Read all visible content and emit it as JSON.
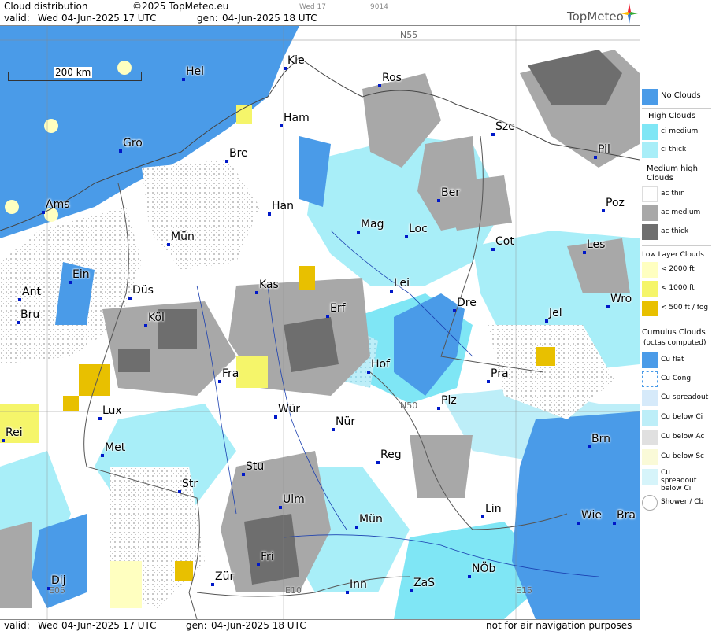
{
  "header": {
    "title": "Cloud distribution",
    "copyright": "©2025 TopMeteo.eu",
    "tab_label": "Wed 17",
    "code": "9014",
    "valid_label": "valid:",
    "valid_value": "Wed  04-Jun-2025  17 UTC",
    "gen_label": "gen:",
    "gen_value": "04-Jun-2025 18 UTC",
    "logo": "TopMeteo"
  },
  "footer": {
    "valid_label": "valid:",
    "valid_value": "Wed  04-Jun-2025  17 UTC",
    "gen_label": "gen:",
    "gen_value": "04-Jun-2025 18 UTC",
    "disclaimer": "not for air navigation purposes"
  },
  "scale": {
    "label": "200 km"
  },
  "grid_labels": [
    "N55",
    "N50",
    "E05",
    "E10",
    "E15"
  ],
  "cities": [
    "Kie",
    "Hel",
    "Ros",
    "Ham",
    "Szc",
    "Gro",
    "Bre",
    "Pil",
    "Ber",
    "Ams",
    "Han",
    "Mag",
    "Loc",
    "Poz",
    "Mün",
    "Cot",
    "Les",
    "Ein",
    "Kas",
    "Lei",
    "Ant",
    "Düs",
    "Wro",
    "Erf",
    "Dre",
    "Bru",
    "Köl",
    "Jel",
    "Hof",
    "Fra",
    "Pra",
    "Lux",
    "Wür",
    "Plz",
    "Rei",
    "Nür",
    "Met",
    "Reg",
    "Brn",
    "Stu",
    "Str",
    "Ulm",
    "Lin",
    "Wie",
    "Bra",
    "Mün",
    "Fri",
    "NÖb",
    "Dij",
    "Zür",
    "Inn",
    "ZaS"
  ],
  "legend": {
    "no_clouds": "No Clouds",
    "high_clouds": "High Clouds",
    "ci_medium": "ci medium",
    "ci_thick": "ci thick",
    "medium_high_clouds": "Medium high Clouds",
    "ac_thin": "ac thin",
    "ac_medium": "ac medium",
    "ac_thick": "ac thick",
    "low_layer_clouds": "Low Layer Clouds",
    "lt2000": "< 2000 ft",
    "lt1000": "< 1000 ft",
    "lt500": "< 500 ft / fog",
    "cumulus_clouds": "Cumulus Clouds",
    "octas": "(octas computed)",
    "cu_flat": "Cu flat",
    "cu_cong": "Cu Cong",
    "cu_spreadout": "Cu spreadout",
    "cu_below_ci": "Cu below Ci",
    "cu_below_ac": "Cu below Ac",
    "cu_below_sc": "Cu below Sc",
    "cu_spreadout_below_ci": "Cu spreadout below Ci",
    "shower_cb": "Shower / Cb"
  },
  "colors": {
    "no_clouds": "#4a9be8",
    "ci_medium": "#7fe6f5",
    "ci_thick": "#a8eef8",
    "ac_thin": "#ffffff",
    "ac_medium": "#a8a8a8",
    "ac_thick": "#6e6e6e",
    "low_2000": "#ffffc0",
    "low_1000": "#f5f56a",
    "fog": "#e8c000",
    "city_dot": "#0018c8"
  }
}
